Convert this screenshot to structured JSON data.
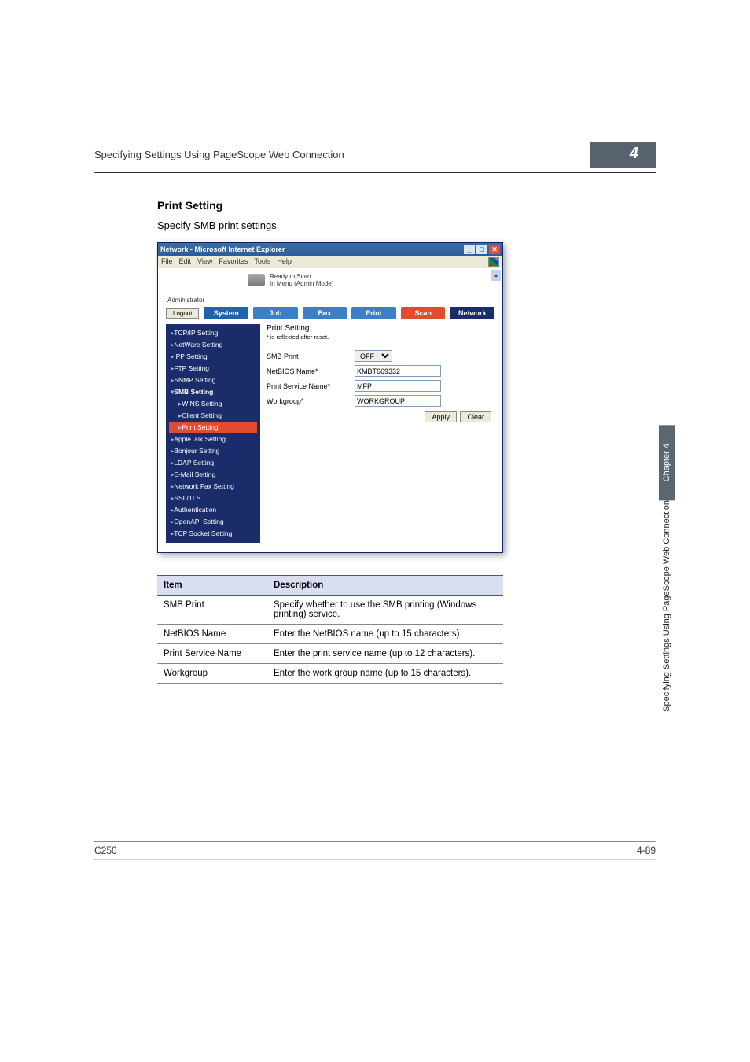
{
  "header": {
    "breadcrumb": "Specifying Settings Using PageScope Web Connection",
    "chapter_num": "4"
  },
  "section": {
    "heading": "Print Setting",
    "intro": "Specify SMB print settings."
  },
  "browser": {
    "title": "Network - Microsoft Internet Explorer",
    "menus": [
      "File",
      "Edit",
      "View",
      "Favorites",
      "Tools",
      "Help"
    ],
    "status_line1": "Ready to Scan",
    "status_line2": "In Menu (Admin Mode)",
    "admin_label": "Administrator",
    "logout": "Logout",
    "tabs": {
      "system": "System",
      "job": "Job",
      "box": "Box",
      "print": "Print",
      "scan": "Scan",
      "network": "Network"
    },
    "sidebar": [
      {
        "label": "TCP/IP Setting",
        "type": "link"
      },
      {
        "label": "NetWare Setting",
        "type": "link"
      },
      {
        "label": "IPP Setting",
        "type": "link"
      },
      {
        "label": "FTP Setting",
        "type": "link"
      },
      {
        "label": "SNMP Setting",
        "type": "link"
      },
      {
        "label": "SMB Setting",
        "type": "smb-head"
      },
      {
        "label": "WINS Setting",
        "type": "sub"
      },
      {
        "label": "Client Setting",
        "type": "sub"
      },
      {
        "label": "Print Setting",
        "type": "sub selected"
      },
      {
        "label": "AppleTalk Setting",
        "type": "link"
      },
      {
        "label": "Bonjour Setting",
        "type": "link"
      },
      {
        "label": "LDAP Setting",
        "type": "link"
      },
      {
        "label": "E-Mail Setting",
        "type": "link"
      },
      {
        "label": "Network Fax Setting",
        "type": "link"
      },
      {
        "label": "SSL/TLS",
        "type": "link"
      },
      {
        "label": "Authentication",
        "type": "link"
      },
      {
        "label": "OpenAPI Setting",
        "type": "link"
      },
      {
        "label": "TCP Socket Setting",
        "type": "link"
      }
    ],
    "panel": {
      "title": "Print Setting",
      "note": "* is reflected after reset.",
      "rows": {
        "smb_print_label": "SMB Print",
        "smb_print_value": "OFF",
        "netbios_label": "NetBIOS Name*",
        "netbios_value": "KMBT669332",
        "psn_label": "Print Service Name*",
        "psn_value": "MFP",
        "wg_label": "Workgroup*",
        "wg_value": "WORKGROUP"
      },
      "apply": "Apply",
      "clear": "Clear"
    }
  },
  "table": {
    "head_item": "Item",
    "head_desc": "Description",
    "rows": [
      {
        "item": "SMB Print",
        "desc": "Specify whether to use the SMB printing (Windows printing) service."
      },
      {
        "item": "NetBIOS Name",
        "desc": "Enter the NetBIOS name (up to 15 characters)."
      },
      {
        "item": "Print Service Name",
        "desc": "Enter the print service name (up to 12 characters)."
      },
      {
        "item": "Workgroup",
        "desc": "Enter the work group name (up to 15 characters)."
      }
    ]
  },
  "side": {
    "chapter": "Chapter 4",
    "title": "Specifying Settings Using PageScope Web Connection"
  },
  "footer": {
    "left": "C250",
    "right": "4-89"
  }
}
